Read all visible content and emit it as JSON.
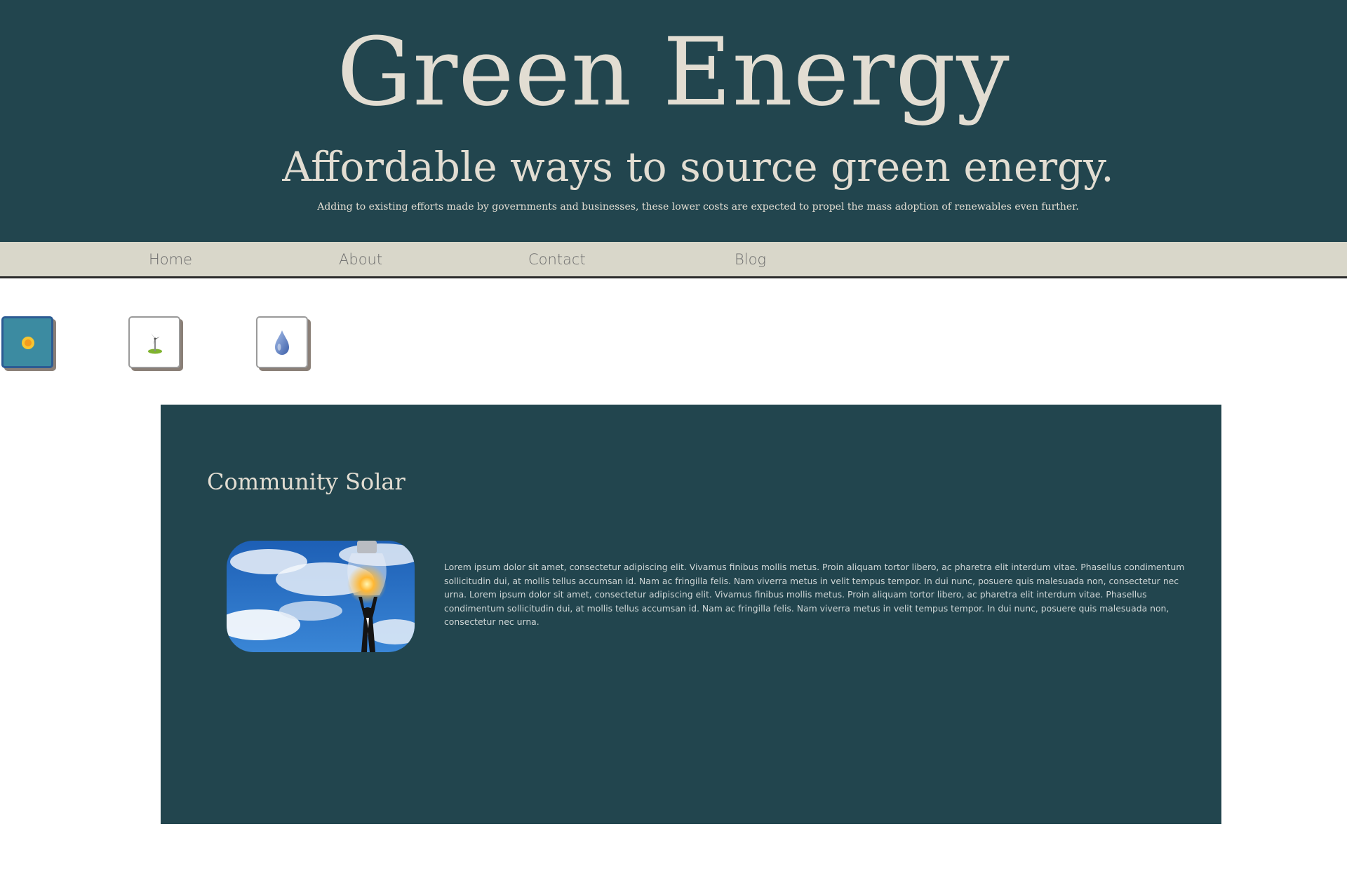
{
  "header": {
    "title": "Green Energy",
    "subtitle": "Affordable ways to source green energy.",
    "blurb": "Adding to existing efforts made by governments and businesses, these lower costs are expected to propel the mass adoption of renewables even further."
  },
  "nav": {
    "items": [
      {
        "label": "Home"
      },
      {
        "label": "About"
      },
      {
        "label": "Contact"
      },
      {
        "label": "Blog"
      }
    ]
  },
  "energy_types": [
    {
      "icon": "sun-icon",
      "active": true
    },
    {
      "icon": "wind-turbine-icon",
      "active": false
    },
    {
      "icon": "water-drop-icon",
      "active": false
    }
  ],
  "panel": {
    "title": "Community Solar",
    "image": "lightbulb-sky-photo",
    "body": "Lorem ipsum dolor sit amet, consectetur adipiscing elit. Vivamus finibus mollis metus. Proin aliquam tortor libero, ac pharetra elit interdum vitae. Phasellus condimentum sollicitudin dui, at mollis tellus accumsan id. Nam ac fringilla felis. Nam viverra metus in velit tempus tempor. In dui nunc, posuere quis malesuada non, consectetur nec urna. Lorem ipsum dolor sit amet, consectetur adipiscing elit. Vivamus finibus mollis metus. Proin aliquam tortor libero, ac pharetra elit interdum vitae. Phasellus condimentum sollicitudin dui, at mollis tellus accumsan id. Nam ac fringilla felis. Nam viverra metus in velit tempus tempor. In dui nunc, posuere quis malesuada non, consectetur nec urna."
  },
  "colors": {
    "brand_dark": "#22454e",
    "cream": "#e2ddd2",
    "nav_bg": "#d9d7ca",
    "active_button": "#3c8ba1"
  }
}
